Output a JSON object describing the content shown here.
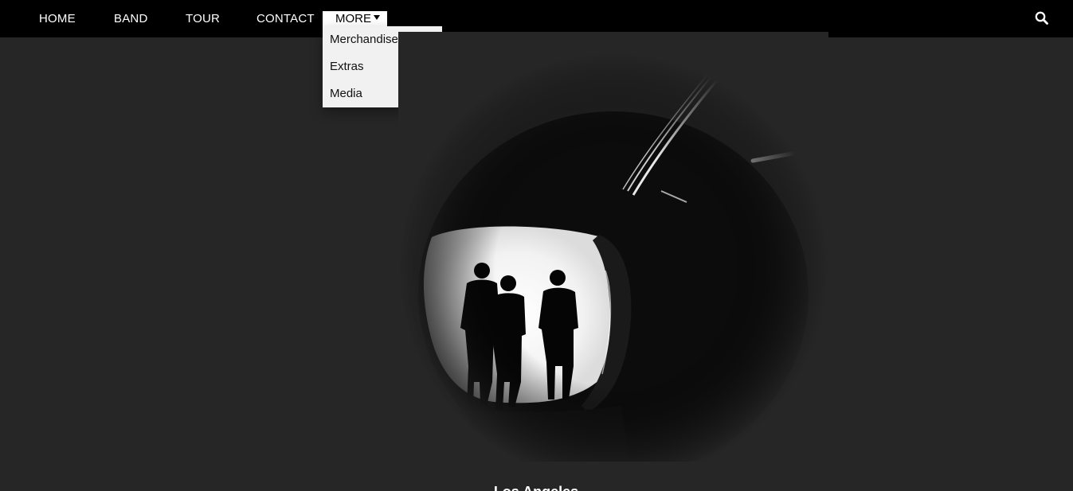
{
  "nav": {
    "items": [
      {
        "label": "HOME"
      },
      {
        "label": "BAND"
      },
      {
        "label": "TOUR"
      },
      {
        "label": "CONTACT"
      }
    ],
    "more": {
      "label": "MORE",
      "caret_icon": "caret-down-icon"
    },
    "search_icon": "search-icon"
  },
  "dropdown": {
    "items": [
      {
        "label": "Merchandise"
      },
      {
        "label": "Extras"
      },
      {
        "label": "Media"
      }
    ]
  },
  "hero": {
    "caption": "Los Angeles"
  },
  "colors": {
    "navbar": "#000000",
    "page_background": "#262626",
    "dropdown_background": "#f1f1f1",
    "active_background": "#ffffff"
  }
}
